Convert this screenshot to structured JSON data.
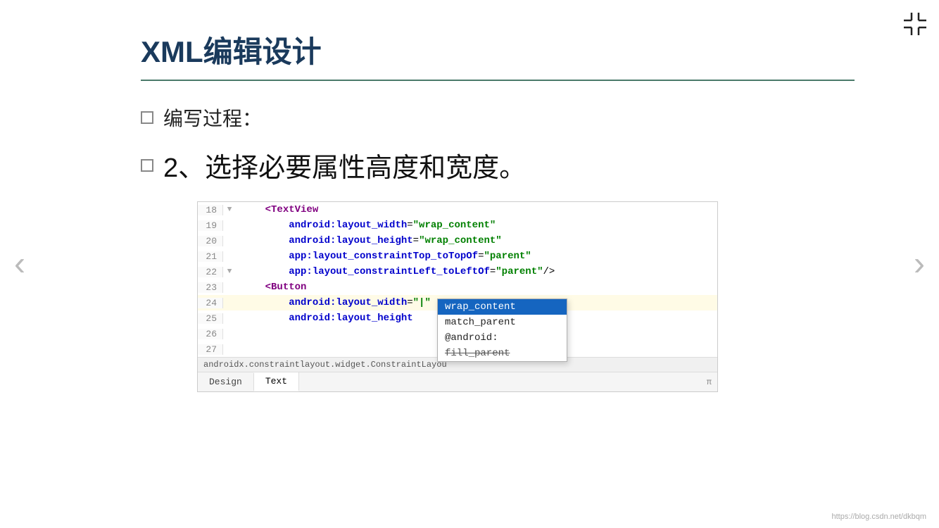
{
  "page": {
    "title": "XML编辑设计",
    "section_label": "编写过程：",
    "step_text": "2、选择必要属性高度和宽度。",
    "nav_left": "‹",
    "nav_right": "›"
  },
  "code_editor": {
    "lines": [
      {
        "num": "18",
        "fold": "▼",
        "content": "    <TextView",
        "type": "tag",
        "highlighted": false
      },
      {
        "num": "19",
        "fold": "",
        "content": "        android:layout_width=\"wrap_content\"",
        "type": "attr",
        "highlighted": false
      },
      {
        "num": "20",
        "fold": "",
        "content": "        android:layout_height=\"wrap_content\"",
        "type": "attr",
        "highlighted": false
      },
      {
        "num": "21",
        "fold": "",
        "content": "        app:layout_constraintTop_toTopOf=\"parent\"",
        "type": "attr",
        "highlighted": false
      },
      {
        "num": "22",
        "fold": "▼",
        "content": "        app:layout_constraintLeft_toLeftOf=\"parent\"/>",
        "type": "attr",
        "highlighted": false
      },
      {
        "num": "23",
        "fold": "",
        "content": "    <Button",
        "type": "tag",
        "highlighted": false
      },
      {
        "num": "24",
        "fold": "",
        "content": "        android:layout_width=\"|\"",
        "type": "attr",
        "highlighted": true
      },
      {
        "num": "25",
        "fold": "",
        "content": "        android:layout_height",
        "type": "attr",
        "highlighted": false
      },
      {
        "num": "26",
        "fold": "",
        "content": "",
        "type": "plain",
        "highlighted": false
      },
      {
        "num": "27",
        "fold": "",
        "content": "",
        "type": "plain",
        "highlighted": false
      }
    ],
    "status_bar": "androidx.constraintlayout.widget.ConstraintLayou",
    "tabs": [
      {
        "label": "Design",
        "active": false
      },
      {
        "label": "Text",
        "active": true
      }
    ],
    "tab_pi": "π"
  },
  "autocomplete": {
    "items": [
      {
        "label": "wrap_content",
        "selected": true
      },
      {
        "label": "match_parent",
        "selected": false
      },
      {
        "label": "@android:",
        "selected": false
      },
      {
        "label": "fill_parent",
        "selected": false
      }
    ]
  },
  "watermark": "https://blog.csdn.net/dkbqm",
  "corner_icon": "compress"
}
